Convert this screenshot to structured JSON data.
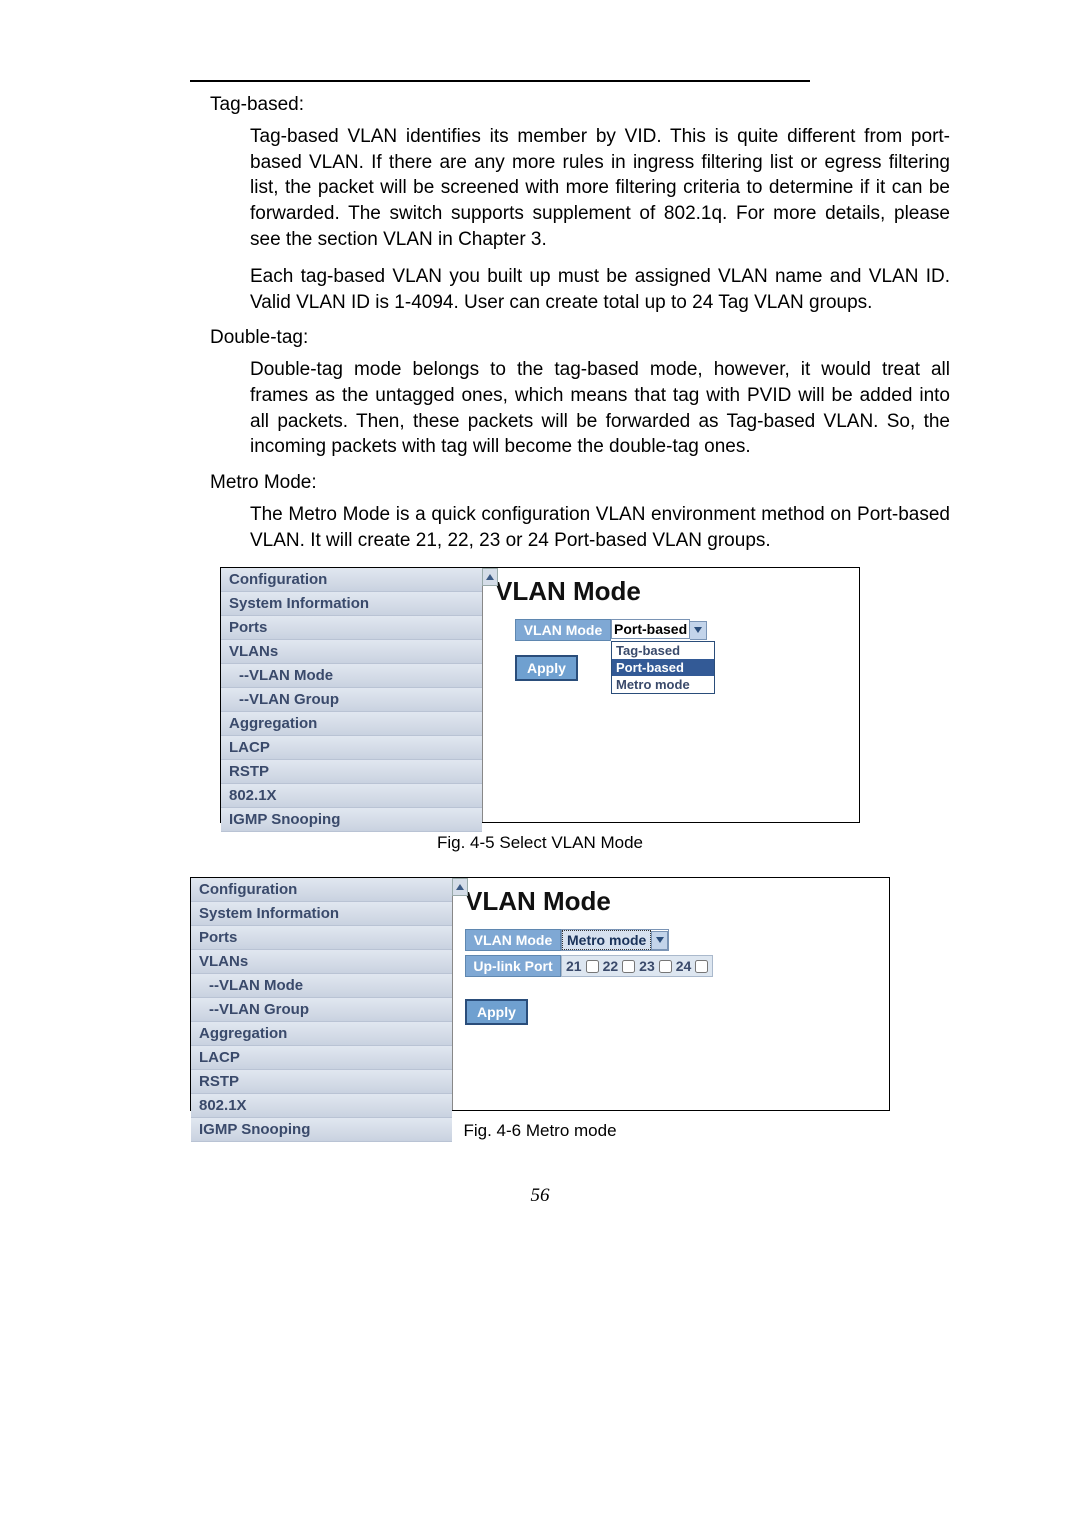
{
  "text": {
    "tagbased_head": "Tag-based:",
    "tagbased_p1": "Tag-based VLAN identifies its member by VID. This is quite different from port-based VLAN. If there are any more rules in ingress filtering list or egress filtering list, the packet will be screened with more filtering criteria to determine if it can be forwarded. The switch supports supplement of 802.1q. For more details, please see the section VLAN in Chapter 3.",
    "tagbased_p2": "Each tag-based VLAN you built up must be assigned VLAN name and VLAN ID. Valid VLAN ID is 1-4094. User can create total up to 24 Tag VLAN groups.",
    "doubletag_head": "Double-tag:",
    "doubletag_p1": "Double-tag mode belongs to the tag-based mode, however, it would treat all frames as the untagged ones, which means that tag with PVID will be added into all packets. Then, these packets will be forwarded as Tag-based VLAN. So, the incoming packets with tag will become the double-tag ones.",
    "metro_head": "Metro Mode:",
    "metro_p1": "The Metro Mode is a quick configuration VLAN environment method on Port-based VLAN. It will create 21, 22, 23 or 24 Port-based VLAN groups.",
    "figcap1": "Fig. 4-5 Select VLAN Mode",
    "figcap2": "Fig. 4-6 Metro mode",
    "pagenum": "56"
  },
  "nav": {
    "configuration": "Configuration",
    "system_info": "System Information",
    "ports": "Ports",
    "vlans": "VLANs",
    "vlan_mode": "--VLAN Mode",
    "vlan_group": "--VLAN Group",
    "aggregation": "Aggregation",
    "lacp": "LACP",
    "rstp": "RSTP",
    "dot1x": "802.1X",
    "igmp": "IGMP Snooping"
  },
  "pane1": {
    "title": "VLAN Mode",
    "mode_label": "VLAN Mode",
    "selected": "Port-based",
    "opt_tag": "Tag-based",
    "opt_port": "Port-based",
    "opt_metro": "Metro mode",
    "apply": "Apply"
  },
  "pane2": {
    "title": "VLAN Mode",
    "mode_label": "VLAN Mode",
    "selected": "Metro mode",
    "uplink_label": "Up-link Port",
    "p21": "21",
    "p22": "22",
    "p23": "23",
    "p24": "24",
    "apply": "Apply"
  }
}
